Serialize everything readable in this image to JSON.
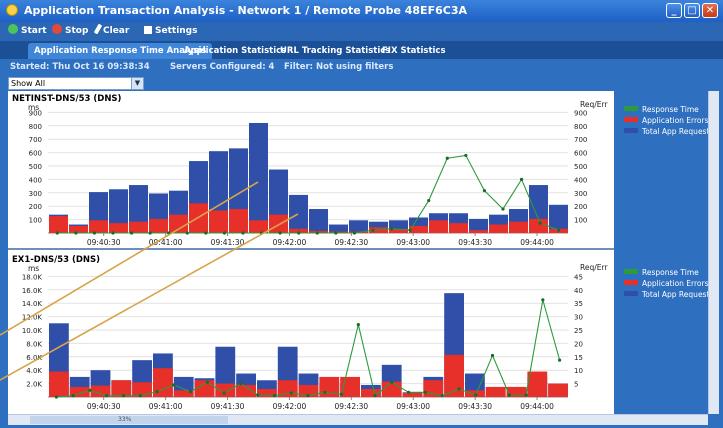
{
  "window": {
    "title": "Application Transaction Analysis - Network 1 / Remote Probe 48EF6C3A"
  },
  "toolbar": {
    "start": "Start",
    "stop": "Stop",
    "clear": "Clear",
    "settings": "Settings"
  },
  "tabs": [
    "Application Response Time Analysis",
    "Application Statistics",
    "URL Tracking Statistics",
    "FIX Statistics"
  ],
  "info": {
    "started": "Started: Thu Oct 16 09:38:34",
    "servers": "Servers Configured: 4",
    "filter": "Filter: Not using filters"
  },
  "filter_select": {
    "value": "Show All"
  },
  "legend": {
    "response_time": "Response Time",
    "app_errors": "Application Errors",
    "total_requests": "Total App Requests"
  },
  "colors": {
    "requests": "#2f4fa8",
    "errors": "#e8302a",
    "response": "#2d9a3e",
    "callout": "#d8a44a"
  },
  "scroll": {
    "percent": "33%"
  },
  "chart_data": [
    {
      "type": "bar",
      "title": "NETINST-DNS/53 (DNS)",
      "ylabel": "ms",
      "ylabel_right": "Req/Err",
      "ylim": [
        0,
        950
      ],
      "yticks": [
        100,
        200,
        300,
        400,
        500,
        600,
        700,
        800,
        900
      ],
      "xticks": [
        "09:40:30",
        "09:41:00",
        "09:41:30",
        "09:42:00",
        "09:42:30",
        "09:43:00",
        "09:43:30",
        "09:44:00"
      ],
      "series": [
        {
          "name": "Total App Requests",
          "values": [
            130,
            60,
            290,
            310,
            340,
            280,
            300,
            510,
            580,
            600,
            780,
            450,
            270,
            170,
            60,
            90,
            80,
            90,
            110,
            140,
            140,
            100,
            130,
            170,
            340,
            200
          ]
        },
        {
          "name": "Application Errors",
          "values": [
            120,
            50,
            90,
            70,
            80,
            100,
            130,
            210,
            160,
            170,
            90,
            130,
            30,
            15,
            10,
            10,
            40,
            30,
            50,
            90,
            70,
            20,
            60,
            80,
            100,
            30
          ]
        },
        {
          "name": "Response Time",
          "values": [
            0,
            0,
            0,
            0,
            0,
            0,
            0,
            0,
            0,
            0,
            0,
            0,
            0,
            0,
            0,
            0,
            0,
            20,
            30,
            20,
            230,
            530,
            550,
            300,
            170,
            380,
            70,
            20
          ]
        }
      ]
    },
    {
      "type": "bar",
      "title": "EX1-DNS/53 (DNS)",
      "ylabel": "ms",
      "ylabel_right": "Req/Err",
      "ylim": [
        0,
        20000
      ],
      "yticks": [
        "2.0K",
        "4.0K",
        "6.0K",
        "8.0K",
        "10.0K",
        "12.0K",
        "14.0K",
        "16.0K",
        "18.0K"
      ],
      "yticks_right": [
        5,
        10,
        15,
        20,
        25,
        30,
        35,
        40,
        45
      ],
      "xticks": [
        "09:40:30",
        "09:41:00",
        "09:41:30",
        "09:42:00",
        "09:42:30",
        "09:43:00",
        "09:43:30",
        "09:44:00"
      ],
      "series": [
        {
          "name": "Total App Requests",
          "values": [
            11000,
            3000,
            4000,
            2500,
            5500,
            6500,
            3000,
            2800,
            7500,
            3500,
            2500,
            7500,
            3500,
            2000,
            2000,
            1800,
            4800,
            700,
            3000,
            15500,
            3500,
            1500,
            1500,
            3000,
            2000
          ]
        },
        {
          "name": "Application Errors",
          "values": [
            3800,
            1500,
            1700,
            2500,
            2200,
            4300,
            1000,
            2500,
            2000,
            1800,
            1200,
            2500,
            1800,
            3000,
            3000,
            1200,
            2300,
            600,
            2500,
            6300,
            1000,
            1500,
            1500,
            3800,
            2000
          ]
        },
        {
          "name": "Response Time",
          "values": [
            0,
            200,
            1000,
            200,
            200,
            200,
            800,
            1800,
            800,
            2200,
            600,
            2000,
            300,
            200,
            600,
            200,
            700,
            400,
            10800,
            200,
            2200,
            700,
            700,
            200,
            1200,
            300,
            6200,
            300,
            300,
            14500,
            5500
          ]
        }
      ]
    }
  ]
}
